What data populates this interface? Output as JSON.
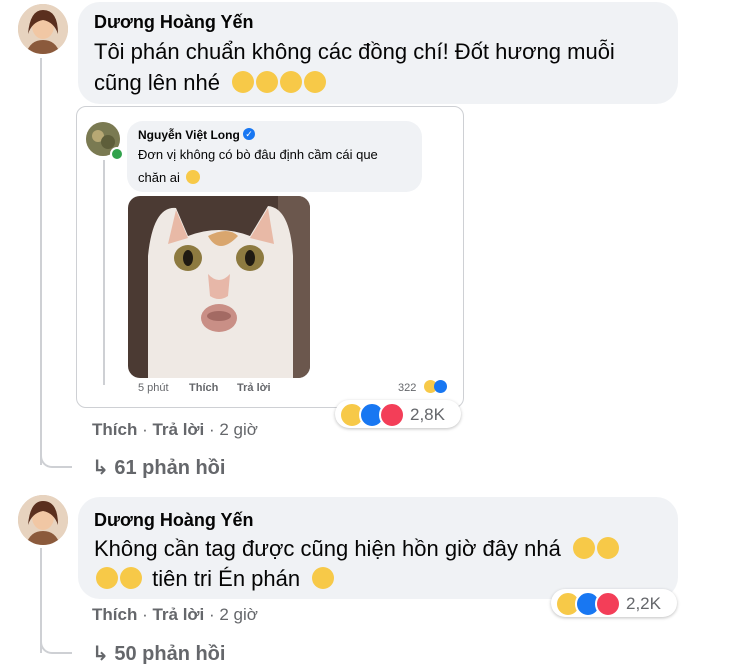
{
  "comments": [
    {
      "author": "Dương Hoàng Yến",
      "line1": "Tôi phán chuẩn không các đồng chí! Đốt hương muỗi",
      "line2": "cũng lên nhé",
      "like": "Thích",
      "reply": "Trả lời",
      "time": "2 giờ",
      "reaction_count": "2,8K",
      "replies_label": "61 phản hồi"
    },
    {
      "author": "Dương Hoàng Yến",
      "line1": "Không cần tag được cũng hiện hồn giờ đây nhá",
      "line2": "tiên tri Én phán",
      "like": "Thích",
      "reply": "Trả lời",
      "time": "2 giờ",
      "reaction_count": "2,2K",
      "replies_label": "50 phản hồi"
    }
  ],
  "embedded": {
    "author": "Nguyễn Việt Long",
    "text_line1": "Đơn vị không có bò đâu định cầm cái que",
    "text_line2": "chăn ai",
    "time": "5 phút",
    "like": "Thích",
    "reply": "Trả lời",
    "reaction_count": "322"
  },
  "colors": {
    "bubble": "#f0f2f5",
    "meta_text": "#65676b",
    "like_blue": "#1877f2",
    "love_red": "#f33e58",
    "haha_yellow": "#f7c948",
    "online_green": "#31a24c"
  }
}
